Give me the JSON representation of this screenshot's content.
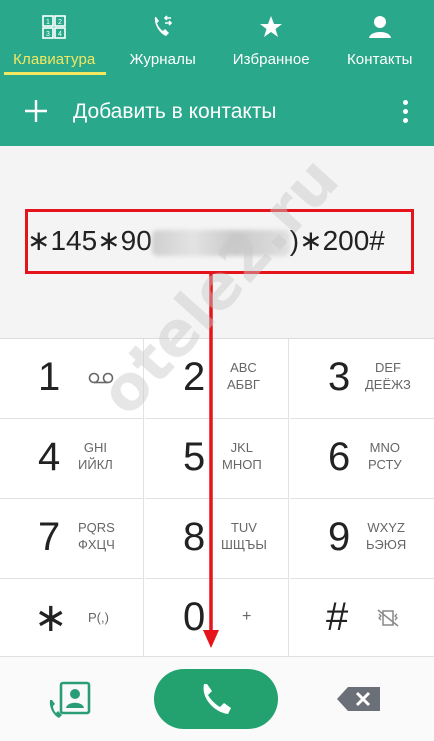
{
  "tabs": [
    {
      "label": "Клавиатура",
      "icon": "dialpad-icon",
      "active": true
    },
    {
      "label": "Журналы",
      "icon": "call-log-icon",
      "active": false
    },
    {
      "label": "Избранное",
      "icon": "star-icon",
      "active": false
    },
    {
      "label": "Контакты",
      "icon": "person-icon",
      "active": false
    }
  ],
  "actionbar": {
    "add_label": "Добавить в контакты"
  },
  "display": {
    "number_start": "∗145∗90",
    "number_end": ")∗200#"
  },
  "keys": [
    {
      "digit": "1",
      "letters": "",
      "sub_icon": "voicemail-icon"
    },
    {
      "digit": "2",
      "letters": "ABC\nАБВГ"
    },
    {
      "digit": "3",
      "letters": "DEF\nДЕЁЖЗ"
    },
    {
      "digit": "4",
      "letters": "GHI\nИЙКЛ"
    },
    {
      "digit": "5",
      "letters": "JKL\nМНОП"
    },
    {
      "digit": "6",
      "letters": "MNO\nРСТУ"
    },
    {
      "digit": "7",
      "letters": "PQRS\nФХЦЧ"
    },
    {
      "digit": "8",
      "letters": "TUV\nШЩЪЫ"
    },
    {
      "digit": "9",
      "letters": "WXYZ\nЬЭЮЯ"
    },
    {
      "digit": "∗",
      "letters": "P(,)"
    },
    {
      "digit": "0",
      "letters": "+"
    },
    {
      "digit": "#",
      "letters": "",
      "sub_icon": "vibrate-off-icon"
    }
  ],
  "bottom": {
    "contacts_icon": "contacts-icon",
    "call_icon": "phone-icon",
    "backspace_icon": "backspace-icon"
  },
  "watermark": "otele2.ru",
  "colors": {
    "header": "#2aa88c",
    "active_tab": "#f3e860",
    "call": "#23a26f",
    "annotation": "#e5141c"
  }
}
